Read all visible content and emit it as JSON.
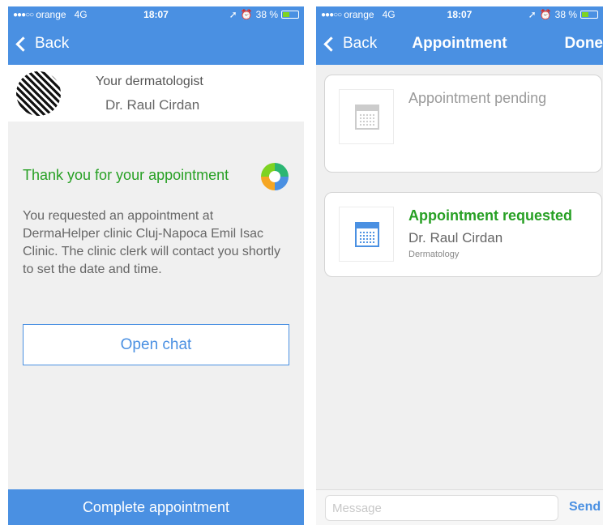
{
  "status_left": {
    "dots": "●●●○○",
    "carrier": "orange",
    "network": "4G",
    "time": "18:07",
    "battery": "38 %",
    "battery_level": 0.38
  },
  "status_right": {
    "dots": "●●●○○",
    "carrier": "orange",
    "network": "4G",
    "time": "18:07",
    "battery": "38 %",
    "battery_level": 0.38
  },
  "left_screen": {
    "nav": {
      "back_label": "Back"
    },
    "doctor": {
      "role": "Your dermatologist",
      "name": "Dr. Raul Cirdan"
    },
    "thanks_title": "Thank you for your appointment",
    "message": "You requested an appointment at DermaHelper clinic Cluj-Napoca Emil Isac Clinic. The clinic clerk will contact you shortly to set the date and time.",
    "open_chat_label": "Open chat",
    "complete_label": "Complete appointment"
  },
  "right_screen": {
    "nav": {
      "back_label": "Back",
      "title": "Appointment",
      "done_label": "Done"
    },
    "cards": [
      {
        "title": "Appointment pending"
      },
      {
        "title": "Appointment requested",
        "doctor": "Dr. Raul Cirdan",
        "specialty": "Dermatology"
      }
    ],
    "message_placeholder": "Message",
    "send_label": "Send"
  },
  "colors": {
    "primary": "#4a90e2",
    "success": "#27a024",
    "background": "#f0f0f0"
  },
  "icons": [
    "back-chevron-icon",
    "location-arrow-icon",
    "alarm-icon",
    "battery-icon",
    "calendar-icon",
    "app-logo-icon"
  ]
}
